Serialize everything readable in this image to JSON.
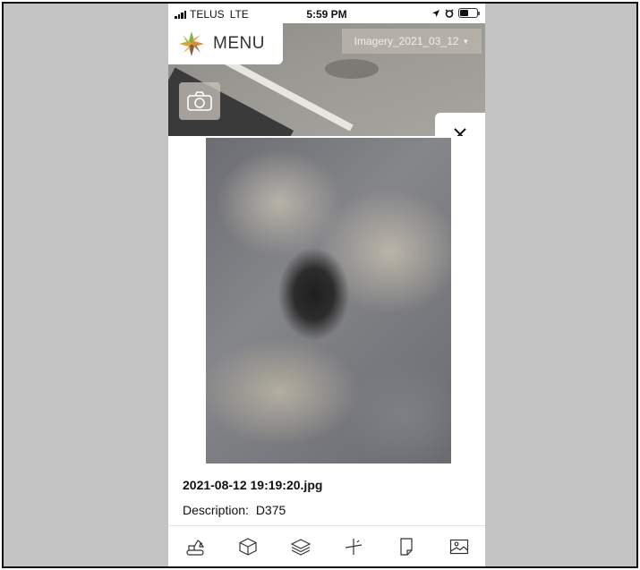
{
  "status_bar": {
    "carrier": "TELUS",
    "network": "LTE",
    "time": "5:59 PM"
  },
  "header": {
    "menu_label": "MENU",
    "imagery_selected": "Imagery_2021_03_12"
  },
  "photo_detail": {
    "filename": "2021-08-12 19:19:20.jpg",
    "description_label": "Description:",
    "description_value": "D375"
  },
  "toolbar": {
    "icons": [
      "excavator-icon",
      "cube-icon",
      "layers-icon",
      "measure-icon",
      "note-icon",
      "image-icon"
    ]
  },
  "colors": {
    "logo_green": "#7fb24a",
    "logo_orange": "#e28a2e",
    "logo_brown": "#8a5a34",
    "logo_gold": "#d6a62e"
  }
}
